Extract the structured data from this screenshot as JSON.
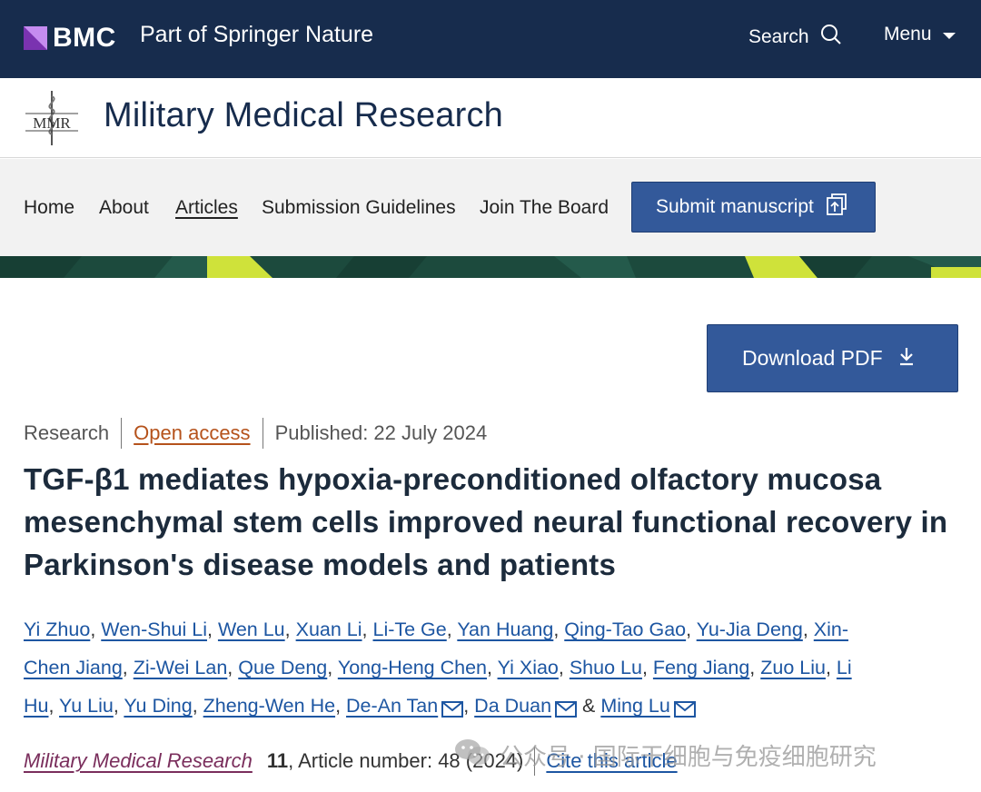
{
  "topbar": {
    "brand": "BMC",
    "springer": "Part of Springer Nature",
    "search_label": "Search",
    "menu_label": "Menu"
  },
  "journal": {
    "logo_text": "MMR",
    "title": "Military Medical Research"
  },
  "nav": {
    "items": [
      {
        "label": "Home"
      },
      {
        "label": "About"
      },
      {
        "label": "Articles",
        "active": true
      },
      {
        "label": "Submission Guidelines"
      },
      {
        "label": "Join The Board"
      }
    ],
    "submit_label": "Submit manuscript"
  },
  "download_label": "Download PDF",
  "meta": {
    "type": "Research",
    "access": "Open access",
    "published": "Published: 22 July 2024"
  },
  "article": {
    "title": "TGF-β1 mediates hypoxia-preconditioned olfactory mucosa mesenchymal stem cells improved neural functional recovery in Parkinson's disease models and patients"
  },
  "authors": {
    "line1": [
      "Yi Zhuo",
      "Wen-Shui Li",
      "Wen Lu",
      "Xuan Li",
      "Li-Te Ge",
      "Yan Huang",
      "Qing-Tao Gao",
      "Yu-Jia Deng",
      "Xin-"
    ],
    "line2": [
      "Chen Jiang",
      "Zi-Wei Lan",
      "Que Deng",
      "Yong-Heng Chen",
      "Yi Xiao",
      "Shuo Lu",
      "Feng Jiang",
      "Zuo Liu",
      "Li"
    ],
    "line3_a": [
      "Hu",
      "Yu Liu",
      "Yu Ding",
      "Zheng-Wen He"
    ],
    "corr1": "De-An Tan",
    "corr2": "Da Duan",
    "conj": "&",
    "corr3": "Ming Lu"
  },
  "citation": {
    "journal": "Military Medical Research",
    "volume": "11",
    "rest": ", Article number: 48 (2024)",
    "cite_label": "Cite this article"
  },
  "watermark": {
    "text": "公众号 · 国际干细胞与免疫细胞研究"
  },
  "colors": {
    "topbar": "#172c4d",
    "button": "#33599a",
    "author_link": "#1d56a2",
    "open_access": "#b5521b",
    "journal_link": "#7a2e5c",
    "banner_dark": "#1c4a3d",
    "banner_accent": "#cfe23a"
  }
}
